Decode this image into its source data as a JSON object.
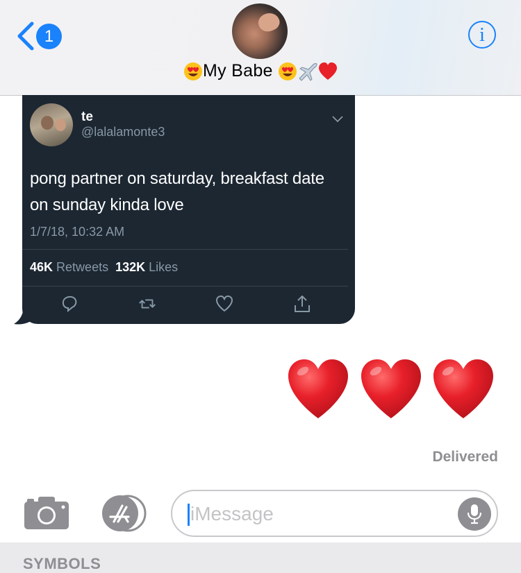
{
  "header": {
    "back_badge": "1",
    "contact_name": "My Babe",
    "info_label": "i"
  },
  "tweet": {
    "name": "te",
    "handle": "@lalalamonte3",
    "text": "pong partner on saturday, breakfast date on sunday kinda love",
    "date": "1/7/18, 10:32 AM",
    "retweets_count": "46K",
    "retweets_label": "Retweets",
    "likes_count": "132K",
    "likes_label": "Likes"
  },
  "messages": {
    "hearts_count": 3,
    "status": "Delivered"
  },
  "input": {
    "placeholder": "iMessage"
  },
  "keyboard": {
    "category_label": "SYMBOLS"
  },
  "colors": {
    "accent": "#1a82fb",
    "tweet_bg": "#1c2732",
    "heart": "#e8202a"
  },
  "icons": [
    "chevron-left-icon",
    "info-icon",
    "heart-eyes-emoji",
    "airplane-emoji",
    "red-heart-emoji",
    "reply-icon",
    "retweet-icon",
    "like-icon",
    "share-icon",
    "camera-icon",
    "app-store-icon",
    "microphone-icon"
  ]
}
